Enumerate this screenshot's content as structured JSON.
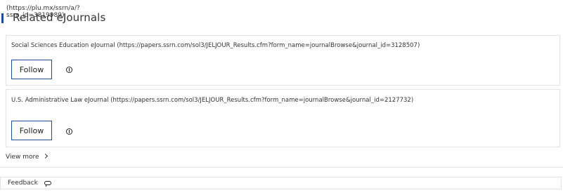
{
  "header": {
    "url_text": "(https://plu.mx/ssrn/a/?ssrn_id=3819989)",
    "title": "Related eJournals"
  },
  "journals": [
    {
      "name": "Social Sciences Education eJournal (https://papers.ssrn.com/sol3/JELJOUR_Results.cfm?form_name=journalBrowse&journal_id=3128507)",
      "follow_label": "Follow"
    },
    {
      "name": "U.S. Administrative Law eJournal (https://papers.ssrn.com/sol3/JELJOUR_Results.cfm?form_name=journalBrowse&journal_id=2127732)",
      "follow_label": "Follow"
    }
  ],
  "view_more_label": "View more",
  "feedback_label": "Feedback",
  "icons": {
    "info": "info-icon",
    "chevron": "chevron-right-icon",
    "feedback": "speech-bubble-icon"
  },
  "colors": {
    "accent": "#1f4e99",
    "border": "#e3e3e3"
  }
}
